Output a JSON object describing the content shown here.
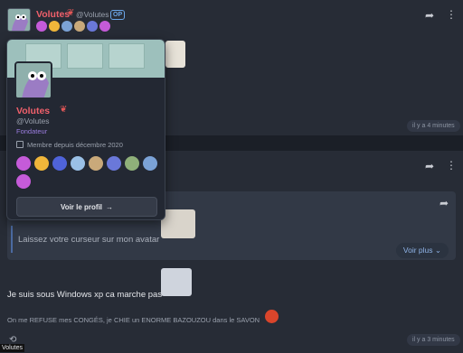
{
  "post1": {
    "author": "Volutes",
    "handle": "@Volutes",
    "op_badge": "OP",
    "timestamp": "il y a 4 minutes",
    "badges": [
      "#c55bd9",
      "#f0b63a",
      "#7ba2d6",
      "#c9a97a",
      "#6a78d9",
      "#c55bd9"
    ]
  },
  "profile_card": {
    "name": "Volutes",
    "handle": "@Volutes",
    "role": "Fondateur",
    "member_since": "Membre depuis décembre 2020",
    "badges": [
      "#c55bd9",
      "#f0b63a",
      "#4f63d9",
      "#9ac0e6",
      "#c9a97a",
      "#6a78d9",
      "#8fb07a",
      "#7ba2d6",
      "#c55bd9"
    ],
    "button_label": "Voir le profil",
    "button_icon": "arrow-right-icon"
  },
  "post2": {
    "quote_text": "Laissez votre curseur sur mon avatar",
    "voir_plus": "Voir plus",
    "message1": "Je suis sous Windows xp ca marche pas",
    "message2": "On me REFUSE mes CONGÉS, je CHIE un ENORME BAZOUZOU dans le SAVON",
    "timestamp": "il y a 3 minutes"
  },
  "footer": {
    "name": "Volutes"
  },
  "colors": {
    "accent_name": "#f0606b",
    "role": "#9b7de0",
    "link": "#8fb3e6"
  }
}
